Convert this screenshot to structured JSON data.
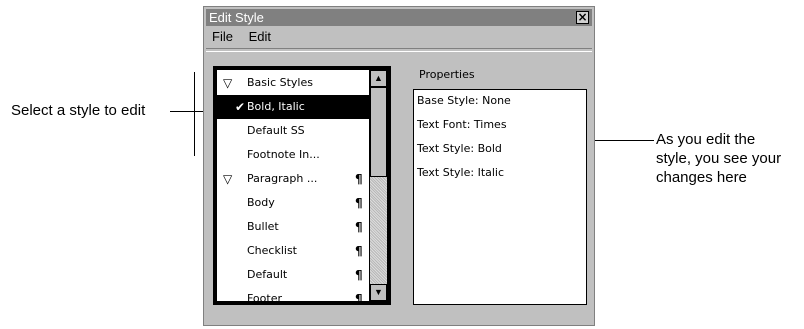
{
  "callouts": {
    "left": "Select a style to edit",
    "right": [
      "As you edit the",
      "style, you see your",
      "changes here"
    ]
  },
  "window": {
    "title": "Edit Style",
    "close_glyph": "×",
    "menu": [
      "File",
      "Edit"
    ]
  },
  "list": {
    "items": [
      {
        "label": "Basic Styles",
        "expander": "▽",
        "check": "",
        "para": ""
      },
      {
        "label": "Bold, Italic",
        "expander": "",
        "check": "✔",
        "para": "",
        "selected": true
      },
      {
        "label": "Default SS",
        "expander": "",
        "check": "",
        "para": ""
      },
      {
        "label": "Footnote In...",
        "expander": "",
        "check": "",
        "para": ""
      },
      {
        "label": "Paragraph ...",
        "expander": "▽",
        "check": "",
        "para": "¶"
      },
      {
        "label": "Body",
        "expander": "",
        "check": "",
        "para": "¶"
      },
      {
        "label": "Bullet",
        "expander": "",
        "check": "",
        "para": "¶"
      },
      {
        "label": "Checklist",
        "expander": "",
        "check": "",
        "para": "¶"
      },
      {
        "label": "Default",
        "expander": "",
        "check": "",
        "para": "¶"
      },
      {
        "label": "Footer",
        "expander": "",
        "check": "",
        "para": "¶"
      }
    ],
    "scroll_up": "▲",
    "scroll_down": "▼"
  },
  "properties": {
    "label": "Properties",
    "lines": [
      "Base Style: None",
      "Text Font: Times",
      "Text Style: Bold",
      "Text Style: Italic"
    ]
  }
}
